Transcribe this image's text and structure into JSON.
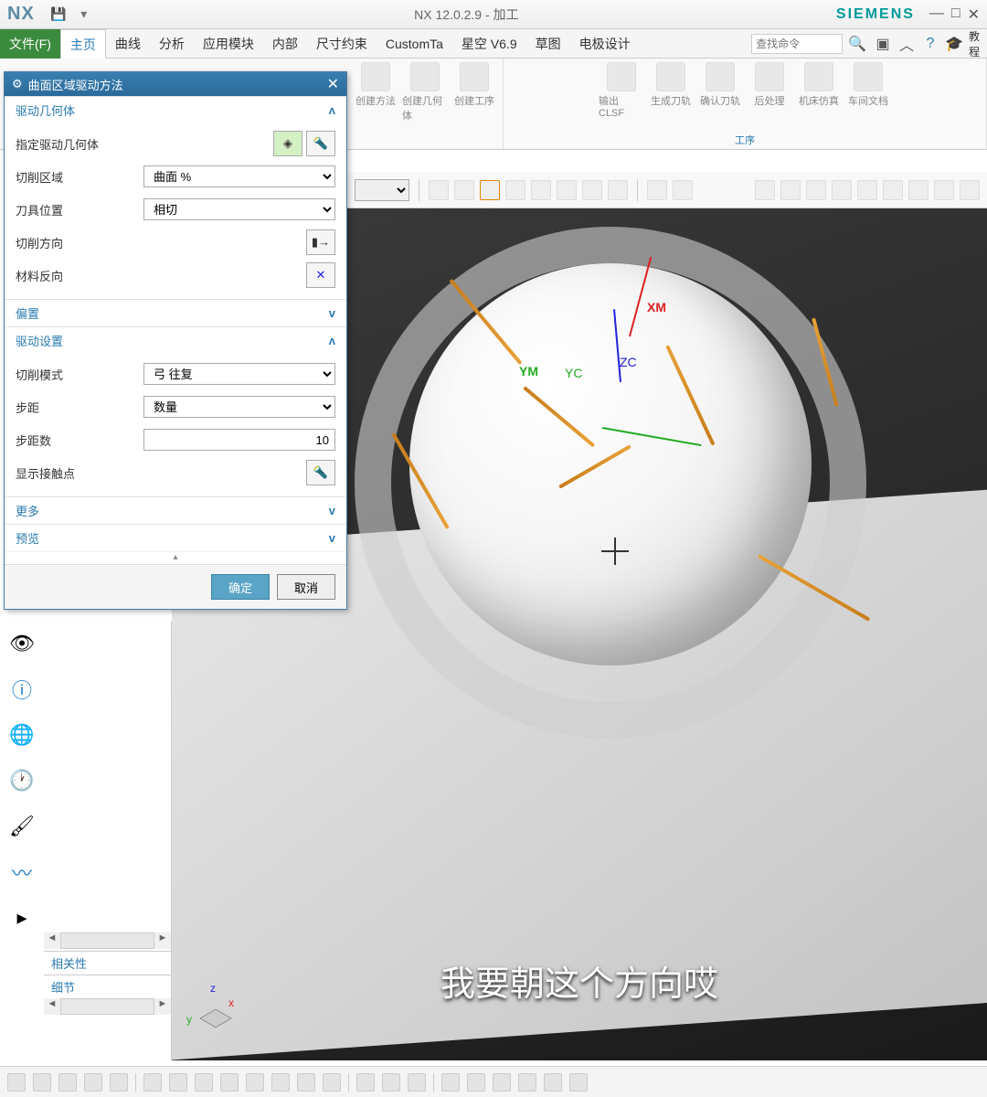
{
  "title_bar": {
    "app": "NX",
    "title": "NX 12.0.2.9 - 加工",
    "brand": "SIEMENS"
  },
  "menu": {
    "file": "文件(F)",
    "tabs": [
      "主页",
      "曲线",
      "分析",
      "应用模块",
      "内部",
      "尺寸约束",
      "CustomTa",
      "星空 V6.9",
      "草图",
      "电极设计"
    ],
    "search_placeholder": "查找命令",
    "tutorial": "教程"
  },
  "ribbon": {
    "g1": [
      "创建方法",
      "创建几何体",
      "创建工序"
    ],
    "g2": [
      "输出 CLSF",
      "生成刀轨",
      "确认刀轨",
      "后处理",
      "机床仿真",
      "车间文档"
    ],
    "group2_label": "工序"
  },
  "dialog": {
    "title": "曲面区域驱动方法",
    "sect_geom": "驱动几何体",
    "specify_geom": "指定驱动几何体",
    "cut_region": "切削区域",
    "cut_region_val": "曲面 %",
    "tool_pos": "刀具位置",
    "tool_pos_val": "相切",
    "cut_dir": "切削方向",
    "mat_rev": "材料反向",
    "sect_offset": "偏置",
    "sect_drive": "驱动设置",
    "cut_mode": "切削模式",
    "cut_mode_val": "弓 往复",
    "step": "步距",
    "step_val": "数量",
    "step_count": "步距数",
    "step_count_val": "10",
    "show_contact": "显示接触点",
    "sect_more": "更多",
    "sect_preview": "预览",
    "ok": "确定",
    "cancel": "取消"
  },
  "nav": {
    "related": "相关性",
    "detail": "细节"
  },
  "viewport": {
    "xm": "XM",
    "ym": "YM",
    "yc": "YC",
    "zc": "ZC",
    "triad_x": "x",
    "triad_y": "y",
    "triad_z": "z",
    "caption": "我要朝这个方向哎"
  }
}
